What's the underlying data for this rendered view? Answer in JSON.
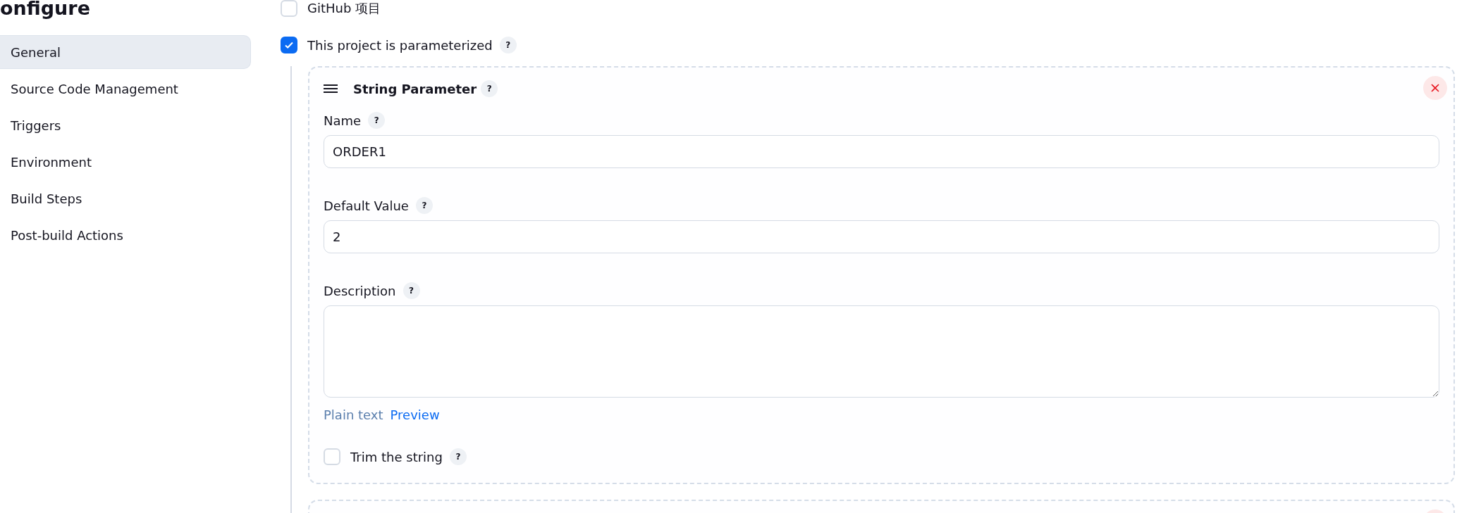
{
  "page_title": "onfigure",
  "sidebar": {
    "items": [
      {
        "label": "General",
        "selected": true
      },
      {
        "label": "Source Code Management",
        "selected": false
      },
      {
        "label": "Triggers",
        "selected": false
      },
      {
        "label": "Environment",
        "selected": false
      },
      {
        "label": "Build Steps",
        "selected": false
      },
      {
        "label": "Post-build Actions",
        "selected": false
      }
    ]
  },
  "options": [
    {
      "label": "GitHub 项目",
      "checked": false
    },
    {
      "label": "This project is parameterized",
      "checked": true,
      "help": "?"
    }
  ],
  "parameters": [
    {
      "kind": "full",
      "title": "String Parameter",
      "help": "?",
      "fields": [
        {
          "kind": "text",
          "label": "Name",
          "help": "?",
          "value": "ORDER1"
        },
        {
          "kind": "text",
          "label": "Default Value",
          "help": "?",
          "value": "2"
        },
        {
          "kind": "textarea",
          "label": "Description",
          "help": "?"
        }
      ],
      "formats": [
        {
          "label": "Plain text",
          "selected": true
        },
        {
          "label": "Preview",
          "selected": false
        }
      ],
      "trim": {
        "label": "Trim the string",
        "checked": false,
        "help": "?"
      }
    },
    {
      "kind": "cut"
    }
  ]
}
